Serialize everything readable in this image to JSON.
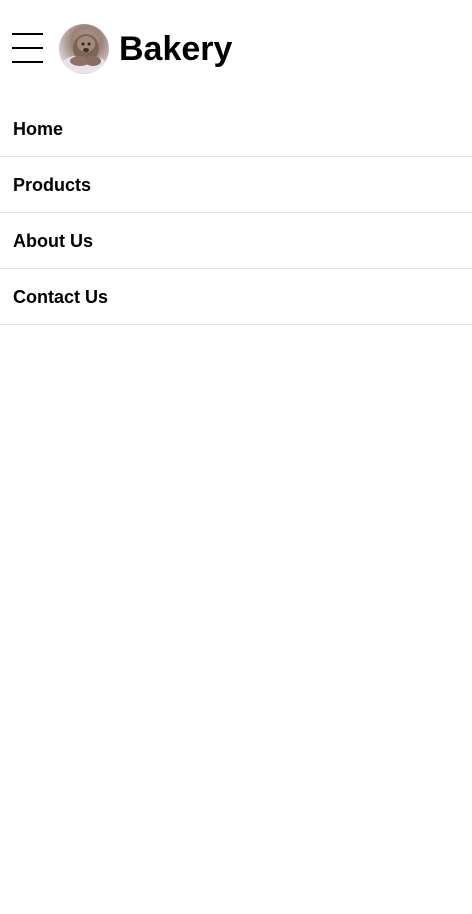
{
  "header": {
    "title": "Bakery",
    "menu_icon": "hamburger-menu-icon",
    "avatar_alt": "bakery-logo-avatar"
  },
  "nav": {
    "items": [
      {
        "label": "Home"
      },
      {
        "label": "Products"
      },
      {
        "label": "About Us"
      },
      {
        "label": "Contact Us"
      }
    ]
  },
  "colors": {
    "background": "#ffffff",
    "text": "#000000",
    "divider": "#e4e4e4"
  }
}
